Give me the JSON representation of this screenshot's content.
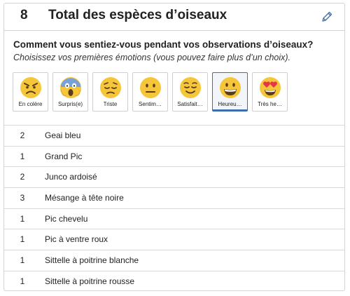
{
  "header": {
    "count": "8",
    "title": "Total des espèces d’oiseaux"
  },
  "prompt": {
    "question": "Comment vous sentiez-vous pendant vos observations d’oiseaux?",
    "hint": "Choisissez vos premières émotions (vous pouvez faire plus d’un choix)."
  },
  "emotions": [
    {
      "label": "En colère",
      "icon": "angry-face-icon",
      "selected": false
    },
    {
      "label": "Surpris(e)",
      "icon": "screaming-face-icon",
      "selected": false
    },
    {
      "label": "Triste",
      "icon": "pensive-face-icon",
      "selected": false
    },
    {
      "label": "Sentim…",
      "icon": "neutral-face-icon",
      "selected": false
    },
    {
      "label": "Satisfait…",
      "icon": "relieved-face-icon",
      "selected": false
    },
    {
      "label": "Heureu…",
      "icon": "grinning-face-icon",
      "selected": true
    },
    {
      "label": "Très he…",
      "icon": "heart-eyes-face-icon",
      "selected": false
    }
  ],
  "species": [
    {
      "count": "2",
      "name": "Geai bleu"
    },
    {
      "count": "1",
      "name": "Grand Pic"
    },
    {
      "count": "2",
      "name": "Junco ardoisé"
    },
    {
      "count": "3",
      "name": "Mésange à tête noire"
    },
    {
      "count": "1",
      "name": "Pic chevelu"
    },
    {
      "count": "1",
      "name": "Pic à ventre roux"
    },
    {
      "count": "1",
      "name": "Sittelle à poitrine blanche"
    },
    {
      "count": "1",
      "name": "Sittelle à poitrine rousse"
    }
  ],
  "colors": {
    "accent": "#3b6fb0",
    "emoji_yellow": "#f5c53a",
    "heart": "#e8344a"
  }
}
